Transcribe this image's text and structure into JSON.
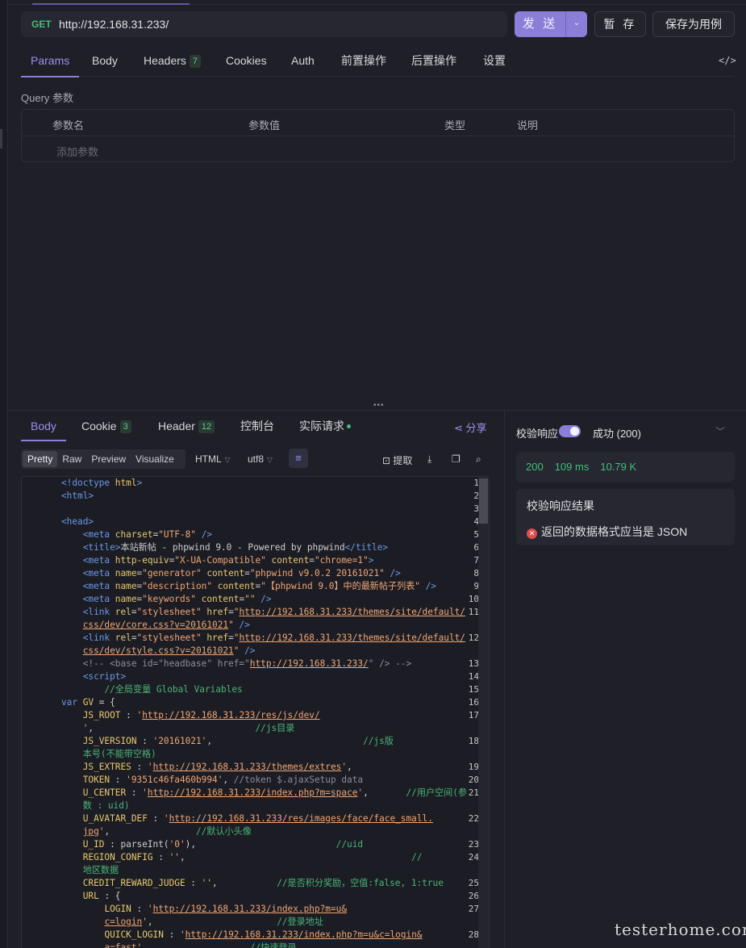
{
  "request": {
    "method": "GET",
    "url": "http://192.168.31.233/",
    "send_label": "发 送",
    "save_label": "暂 存",
    "save_as_label": "保存为用例"
  },
  "request_tabs": [
    {
      "label": "Params"
    },
    {
      "label": "Body"
    },
    {
      "label": "Headers",
      "count": "7"
    },
    {
      "label": "Cookies"
    },
    {
      "label": "Auth"
    },
    {
      "label": "前置操作"
    },
    {
      "label": "后置操作"
    },
    {
      "label": "设置"
    }
  ],
  "code_icon": "</>",
  "query": {
    "label": "Query 参数",
    "columns": [
      "参数名",
      "参数值",
      "类型",
      "说明"
    ],
    "add_placeholder": "添加参数"
  },
  "response_tabs": [
    {
      "label": "Body"
    },
    {
      "label": "Cookie",
      "count": "3"
    },
    {
      "label": "Header",
      "count": "12"
    },
    {
      "label": "控制台"
    },
    {
      "label": "实际请求"
    }
  ],
  "share_label": "分享",
  "view_modes": [
    "Pretty",
    "Raw",
    "Preview",
    "Visualize"
  ],
  "format": "HTML",
  "encoding": "utf8",
  "extract_label": "提取",
  "verify": {
    "label": "校验响应",
    "enabled": true,
    "result_status": "成功 (200)",
    "stats": {
      "status": "200",
      "time": "109 ms",
      "size": "10.79 K"
    },
    "result_title": "校验响应结果",
    "error_message": "返回的数据格式应当是 JSON"
  },
  "code_lines": [
    {
      "n": "1",
      "parts": [
        [
          "tag",
          "<!doctype "
        ],
        [
          "attr",
          "html"
        ],
        [
          "tag",
          ">"
        ]
      ]
    },
    {
      "n": "2",
      "parts": [
        [
          "tag",
          "<html>"
        ]
      ]
    },
    {
      "n": "3",
      "parts": []
    },
    {
      "n": "4",
      "parts": [
        [
          "tag",
          "<head>"
        ]
      ]
    },
    {
      "n": "5",
      "parts": [
        [
          "",
          "    "
        ],
        [
          "tag",
          "<meta "
        ],
        [
          "attr",
          "charset"
        ],
        [
          "",
          "="
        ],
        [
          "str",
          "\"UTF-8\""
        ],
        [
          "tag",
          " />"
        ]
      ]
    },
    {
      "n": "6",
      "parts": [
        [
          "",
          "    "
        ],
        [
          "tag",
          "<title>"
        ],
        [
          "",
          "本站新帖 - phpwind 9.0 - Powered by phpwind"
        ],
        [
          "tag",
          "</title>"
        ]
      ]
    },
    {
      "n": "7",
      "parts": [
        [
          "",
          "    "
        ],
        [
          "tag",
          "<meta "
        ],
        [
          "attr",
          "http-equiv"
        ],
        [
          "",
          "="
        ],
        [
          "str",
          "\"X-UA-Compatible\""
        ],
        [
          "",
          " "
        ],
        [
          "attr",
          "content"
        ],
        [
          "",
          "="
        ],
        [
          "str",
          "\"chrome=1\""
        ],
        [
          "tag",
          ">"
        ]
      ]
    },
    {
      "n": "8",
      "parts": [
        [
          "",
          "    "
        ],
        [
          "tag",
          "<meta "
        ],
        [
          "attr",
          "name"
        ],
        [
          "",
          "="
        ],
        [
          "str",
          "\"generator\""
        ],
        [
          "",
          " "
        ],
        [
          "attr",
          "content"
        ],
        [
          "",
          "="
        ],
        [
          "str",
          "\"phpwind v9.0.2 20161021\""
        ],
        [
          "tag",
          " />"
        ]
      ]
    },
    {
      "n": "9",
      "parts": [
        [
          "",
          "    "
        ],
        [
          "tag",
          "<meta "
        ],
        [
          "attr",
          "name"
        ],
        [
          "",
          "="
        ],
        [
          "str",
          "\"description\""
        ],
        [
          "",
          " "
        ],
        [
          "attr",
          "content"
        ],
        [
          "",
          "="
        ],
        [
          "str",
          "\"【phpwind 9.0】中的最新帖子列表\""
        ],
        [
          "tag",
          " />"
        ]
      ]
    },
    {
      "n": "10",
      "parts": [
        [
          "",
          "    "
        ],
        [
          "tag",
          "<meta "
        ],
        [
          "attr",
          "name"
        ],
        [
          "",
          "="
        ],
        [
          "str",
          "\"keywords\""
        ],
        [
          "",
          " "
        ],
        [
          "attr",
          "content"
        ],
        [
          "",
          "="
        ],
        [
          "str",
          "\"\""
        ],
        [
          "tag",
          " />"
        ]
      ]
    },
    {
      "n": "11",
      "parts": [
        [
          "",
          "    "
        ],
        [
          "tag",
          "<link "
        ],
        [
          "attr",
          "rel"
        ],
        [
          "",
          "="
        ],
        [
          "str",
          "\"stylesheet\""
        ],
        [
          "",
          " "
        ],
        [
          "attr",
          "href"
        ],
        [
          "",
          "="
        ],
        [
          "str",
          "\""
        ],
        [
          "url",
          "http://192.168.31.233/themes/site/default/"
        ]
      ]
    },
    {
      "n": "",
      "parts": [
        [
          "",
          "    "
        ],
        [
          "url",
          "css/dev/core.css?v=20161021"
        ],
        [
          "str",
          "\""
        ],
        [
          "tag",
          " />"
        ]
      ]
    },
    {
      "n": "12",
      "parts": [
        [
          "",
          "    "
        ],
        [
          "tag",
          "<link "
        ],
        [
          "attr",
          "rel"
        ],
        [
          "",
          "="
        ],
        [
          "str",
          "\"stylesheet\""
        ],
        [
          "",
          " "
        ],
        [
          "attr",
          "href"
        ],
        [
          "",
          "="
        ],
        [
          "str",
          "\""
        ],
        [
          "url",
          "http://192.168.31.233/themes/site/default/"
        ]
      ]
    },
    {
      "n": "",
      "parts": [
        [
          "",
          "    "
        ],
        [
          "url",
          "css/dev/style.css?v=20161021"
        ],
        [
          "str",
          "\""
        ],
        [
          "tag",
          " />"
        ]
      ]
    },
    {
      "n": "13",
      "parts": [
        [
          "",
          "    "
        ],
        [
          "com",
          "<!-- <base id=\"headbase\" href=\""
        ],
        [
          "url",
          "http://192.168.31.233/"
        ],
        [
          "com",
          "\" /> -->"
        ]
      ]
    },
    {
      "n": "14",
      "parts": [
        [
          "",
          "    "
        ],
        [
          "tag",
          "<script>"
        ]
      ]
    },
    {
      "n": "15",
      "parts": [
        [
          "",
          "        "
        ],
        [
          "cm-green",
          "//全局变量 Global Variables"
        ]
      ]
    },
    {
      "n": "16",
      "parts": [
        [
          "kw",
          "var "
        ],
        [
          "key",
          "GV"
        ],
        [
          "",
          " = {"
        ]
      ]
    },
    {
      "n": "17",
      "parts": [
        [
          "",
          "    "
        ],
        [
          "key",
          "JS_ROOT"
        ],
        [
          "",
          " : "
        ],
        [
          "str",
          "'"
        ],
        [
          "url",
          "http://192.168.31.233/res/js/dev/"
        ]
      ]
    },
    {
      "n": "",
      "parts": [
        [
          "",
          "    "
        ],
        [
          "str",
          "'"
        ],
        [
          "",
          ",                              "
        ],
        [
          "cm-green",
          "//js目录"
        ]
      ]
    },
    {
      "n": "18",
      "parts": [
        [
          "",
          "    "
        ],
        [
          "key",
          "JS_VERSION"
        ],
        [
          "",
          " : "
        ],
        [
          "str",
          "'20161021'"
        ],
        [
          "",
          ",                            "
        ],
        [
          "cm-green",
          "//js版"
        ]
      ]
    },
    {
      "n": "",
      "parts": [
        [
          "",
          "    "
        ],
        [
          "cm-green",
          "本号(不能带空格)"
        ]
      ]
    },
    {
      "n": "19",
      "parts": [
        [
          "",
          "    "
        ],
        [
          "key",
          "JS_EXTRES"
        ],
        [
          "",
          " : "
        ],
        [
          "str",
          "'"
        ],
        [
          "url",
          "http://192.168.31.233/themes/extres"
        ],
        [
          "str",
          "'"
        ],
        [
          "",
          ","
        ]
      ]
    },
    {
      "n": "20",
      "parts": [
        [
          "",
          "    "
        ],
        [
          "key",
          "TOKEN"
        ],
        [
          "",
          " : "
        ],
        [
          "str",
          "'9351c46fa460b994'"
        ],
        [
          "",
          ", "
        ],
        [
          "com",
          "//token $.ajaxSetup data"
        ]
      ]
    },
    {
      "n": "21",
      "parts": [
        [
          "",
          "    "
        ],
        [
          "key",
          "U_CENTER"
        ],
        [
          "",
          " : "
        ],
        [
          "str",
          "'"
        ],
        [
          "url",
          "http://192.168.31.233/index.php?m=space"
        ],
        [
          "str",
          "'"
        ],
        [
          "",
          ",       "
        ],
        [
          "cm-green",
          "//用户空间(参"
        ]
      ]
    },
    {
      "n": "",
      "parts": [
        [
          "",
          "    "
        ],
        [
          "cm-green",
          "数 : uid)"
        ]
      ]
    },
    {
      "n": "22",
      "parts": [
        [
          "",
          "    "
        ],
        [
          "key",
          "U_AVATAR_DEF"
        ],
        [
          "",
          " : "
        ],
        [
          "str",
          "'"
        ],
        [
          "url",
          "http://192.168.31.233/res/images/face/face_small."
        ]
      ]
    },
    {
      "n": "",
      "parts": [
        [
          "",
          "    "
        ],
        [
          "url",
          "jpg"
        ],
        [
          "str",
          "'"
        ],
        [
          "",
          ",                "
        ],
        [
          "cm-green",
          "//默认小头像"
        ]
      ]
    },
    {
      "n": "23",
      "parts": [
        [
          "",
          "    "
        ],
        [
          "key",
          "U_ID"
        ],
        [
          "",
          " : parseInt("
        ],
        [
          "str",
          "'0'"
        ],
        [
          "",
          "),                          "
        ],
        [
          "cm-green",
          "//uid"
        ]
      ]
    },
    {
      "n": "24",
      "parts": [
        [
          "",
          "    "
        ],
        [
          "key",
          "REGION_CONFIG"
        ],
        [
          "",
          " : "
        ],
        [
          "str",
          "''"
        ],
        [
          "",
          ",                                          "
        ],
        [
          "cm-green",
          "//"
        ]
      ]
    },
    {
      "n": "",
      "parts": [
        [
          "",
          "    "
        ],
        [
          "cm-green",
          "地区数据"
        ]
      ]
    },
    {
      "n": "25",
      "parts": [
        [
          "",
          "    "
        ],
        [
          "key",
          "CREDIT_REWARD_JUDGE"
        ],
        [
          "",
          " : "
        ],
        [
          "str",
          "''"
        ],
        [
          "",
          ",           "
        ],
        [
          "cm-green",
          "//是否积分奖励，空值:false, 1:true"
        ]
      ]
    },
    {
      "n": "26",
      "parts": [
        [
          "",
          "    "
        ],
        [
          "key",
          "URL"
        ],
        [
          "",
          " : {"
        ]
      ]
    },
    {
      "n": "27",
      "parts": [
        [
          "",
          "        "
        ],
        [
          "key",
          "LOGIN"
        ],
        [
          "",
          " : "
        ],
        [
          "str",
          "'"
        ],
        [
          "url",
          "http://192.168.31.233/index.php?m=u&"
        ]
      ]
    },
    {
      "n": "",
      "parts": [
        [
          "",
          "        "
        ],
        [
          "url",
          "c=login"
        ],
        [
          "str",
          "'"
        ],
        [
          "",
          ",                       "
        ],
        [
          "cm-green",
          "//登录地址"
        ]
      ]
    },
    {
      "n": "28",
      "parts": [
        [
          "",
          "        "
        ],
        [
          "key",
          "QUICK_LOGIN"
        ],
        [
          "",
          " : "
        ],
        [
          "str",
          "'"
        ],
        [
          "url",
          "http://192.168.31.233/index.php?m=u&c=login&"
        ]
      ]
    },
    {
      "n": "",
      "parts": [
        [
          "",
          "        "
        ],
        [
          "url",
          "a=fast"
        ],
        [
          "str",
          "'"
        ],
        [
          "",
          ",                   "
        ],
        [
          "cm-green",
          "//快速登录"
        ]
      ]
    }
  ],
  "watermark": "testerhome.com"
}
